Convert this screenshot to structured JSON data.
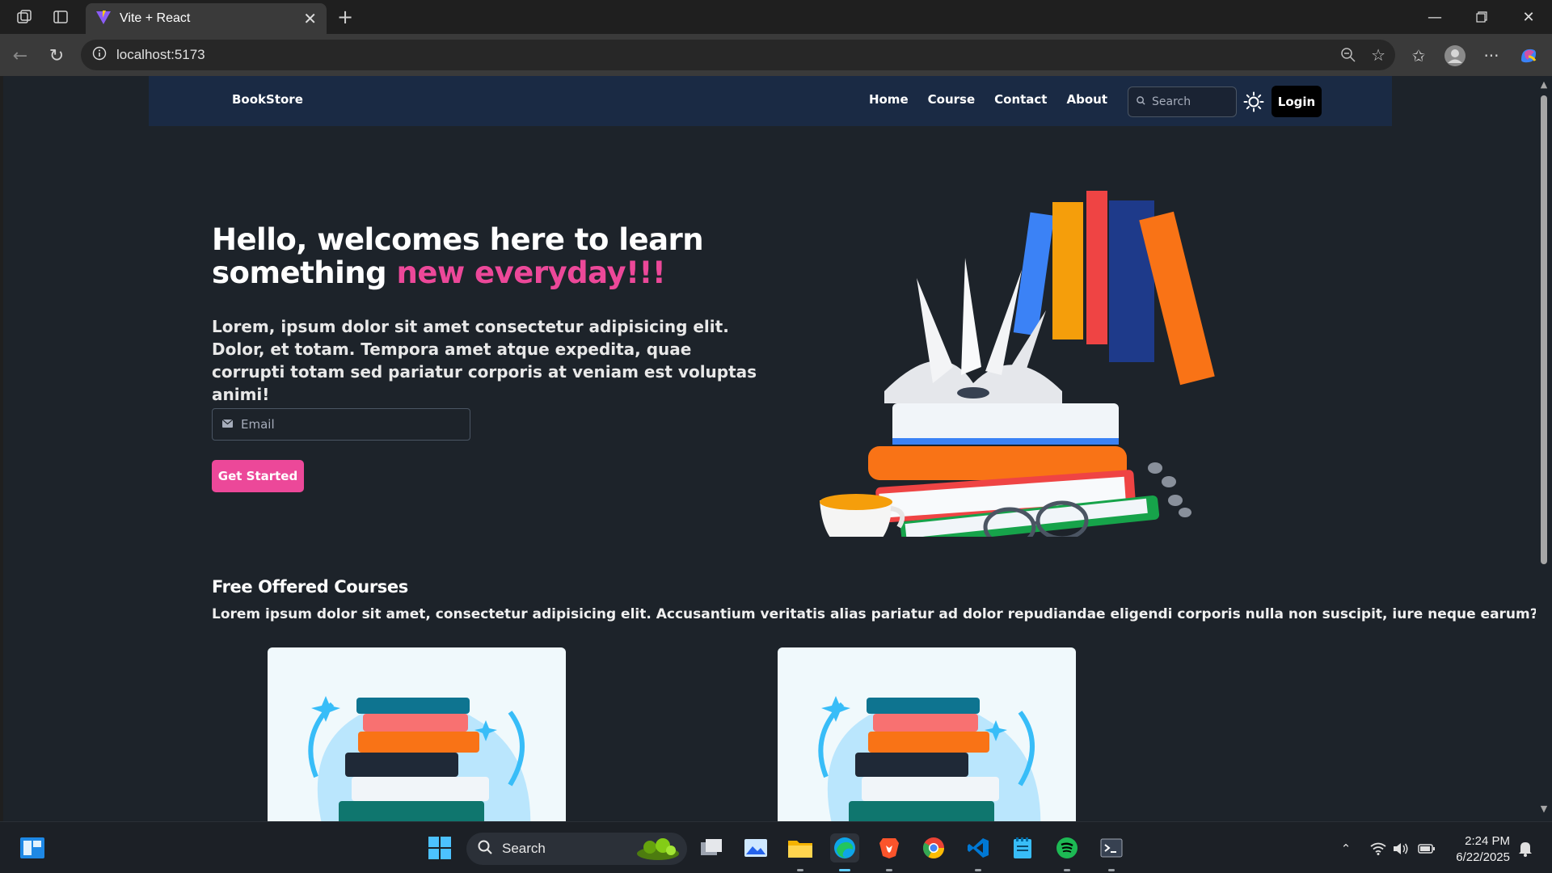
{
  "browser": {
    "tab_title": "Vite + React",
    "url": "localhost:5173"
  },
  "site": {
    "brand": "BookStore",
    "nav": [
      {
        "label": "Home"
      },
      {
        "label": "Course"
      },
      {
        "label": "Contact"
      },
      {
        "label": "About"
      }
    ],
    "search_placeholder": "Search",
    "login_label": "Login"
  },
  "hero": {
    "title_line1": "Hello, welcomes here to learn",
    "title_line2_plain": "something ",
    "title_line2_accent": "new everyday!!!",
    "description": "Lorem, ipsum dolor sit amet consectetur adipisicing elit. Dolor, et totam. Tempora amet atque expedita, quae corrupti totam sed pariatur corporis at veniam est voluptas animi!",
    "email_placeholder": "Email",
    "cta_label": "Get Started"
  },
  "courses": {
    "title": "Free Offered Courses",
    "description": "Lorem ipsum dolor sit amet, consectetur adipisicing elit. Accusantium veritatis alias pariatur ad dolor repudiandae eligendi corporis nulla non suscipit, iure neque earum?"
  },
  "taskbar": {
    "search_label": "Search",
    "time": "2:24 PM",
    "date": "6/22/2025"
  },
  "colors": {
    "accent": "#ec4899",
    "page_bg": "#1d232a",
    "navbar_bg": "#1a2a44"
  }
}
